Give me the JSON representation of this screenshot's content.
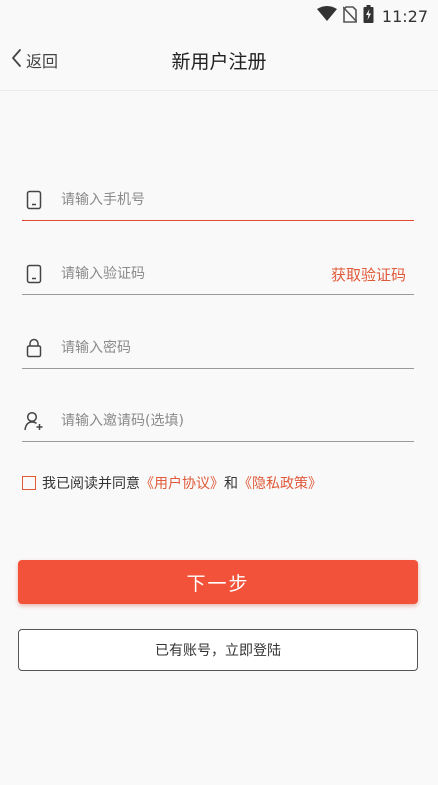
{
  "status_bar": {
    "time": "11:27",
    "icons": [
      "wifi-icon",
      "no-sim-icon",
      "battery-charging-icon"
    ]
  },
  "header": {
    "back_label": "返回",
    "title": "新用户注册"
  },
  "form": {
    "phone": {
      "placeholder": "请输入手机号",
      "value": "",
      "icon": "phone-icon"
    },
    "code": {
      "placeholder": "请输入验证码",
      "value": "",
      "icon": "phone-icon",
      "action_label": "获取验证码"
    },
    "password": {
      "placeholder": "请输入密码",
      "value": "",
      "icon": "lock-icon"
    },
    "invite": {
      "placeholder": "请输入邀请码(选填)",
      "value": "",
      "icon": "user-add-icon"
    }
  },
  "agreement": {
    "checked": false,
    "prefix": "我已阅读并同意",
    "user_agreement": "《用户协议》",
    "and": "和",
    "privacy_policy": "《隐私政策》"
  },
  "actions": {
    "next_label": "下一步",
    "login_label": "已有账号，立即登陆"
  },
  "colors": {
    "accent": "#f2523a",
    "link": "#e05a3a",
    "background": "#f9f9f9"
  }
}
